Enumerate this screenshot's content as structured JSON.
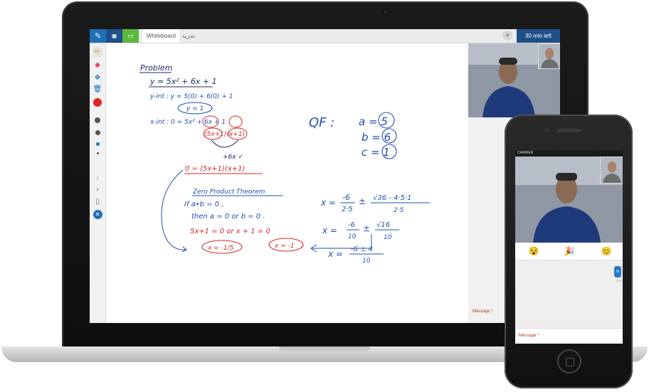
{
  "app": {
    "tabs": {
      "whiteboard": "Whiteboard",
      "second": "تجربة"
    },
    "timer": "30 min left",
    "add_tab": "+"
  },
  "chat": {
    "message_placeholder": "Message *"
  },
  "phone": {
    "carrier": "CARRIER",
    "message_placeholder": "Message *",
    "chat_bubble": "hi",
    "bubble_time": "1:57"
  },
  "whiteboard": {
    "problem_title": "Problem",
    "equation": "y = 5x² + 6x + 1",
    "y_int_line": "y-int : y = 5(0) + 6(0) + 1",
    "y_int_result": "y = 1",
    "x_int_line": "x-int : 0 = 5x² + 6x + 1",
    "factored": "(5x+1)(x+1)",
    "check": "+6x ✓",
    "zero_eq": "0 = (5x+1)(x+1)",
    "zpt_title": "Zero Product Theorem",
    "zpt_if": "If  a•b = 0 ,",
    "zpt_then": "then  a = 0  or  b = 0 .",
    "solve_line": "5x+1 = 0    or    x + 1 = 0",
    "sol1": "x = -1/5",
    "sol2": "x = -1",
    "qf_label": "QF :",
    "qf_a": "a = 5",
    "qf_b": "b = 6",
    "qf_c": "c = 1",
    "qf1_lhs": "x =",
    "qf1_num_a": "-6",
    "qf1_den_a": "2·5",
    "qf1_pm": "±",
    "qf1_num_b": "√36 - 4·5·1",
    "qf1_den_b": "2·5",
    "qf2_num_a": "-6",
    "qf2_den_a": "10",
    "qf2_num_b": "√16",
    "qf2_den_b": "10",
    "qf3_num": "-6 ± 4",
    "qf3_den": "10"
  },
  "colors": {
    "ink_dark": "#1b2a6b",
    "ink_blue": "#1f4fb0",
    "ink_red": "#d32a2a",
    "brand_blue": "#1e6fb5",
    "brand_green": "#5cb83c",
    "timer_bg": "#1f4f8a"
  },
  "icons": [
    "pen-icon",
    "terminal-icon",
    "screen-share-icon",
    "pencil-icon",
    "eraser-icon",
    "move-icon",
    "trash-icon",
    "color-red-icon",
    "dot-size-icon",
    "undo-icon",
    "arrow-icon",
    "page-icon",
    "close-icon",
    "plus-icon"
  ]
}
